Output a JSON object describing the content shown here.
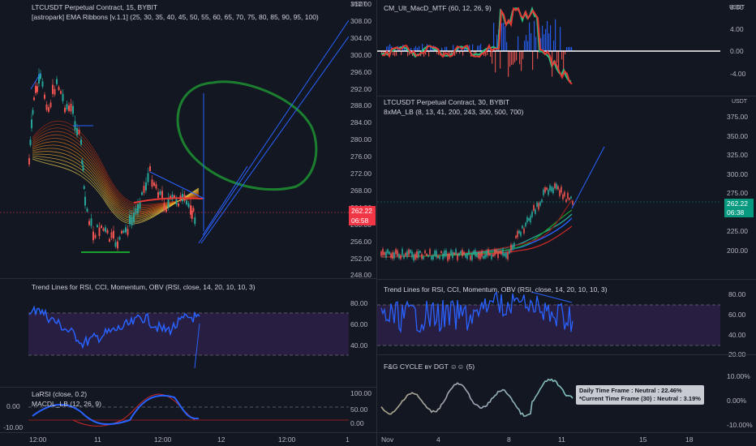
{
  "left": {
    "main": {
      "symbol": "LTCUSDT Perpetual Contract, 15, BYBIT",
      "indicator": "[astropark] EMA Ribbons [v.1.1] (25, 30, 35, 40, 45, 50, 55, 60, 65, 70, 75, 80, 85, 90, 95, 100)",
      "currency": "USDT",
      "price_axis": [
        "312.00",
        "308.00",
        "304.00",
        "300.00",
        "296.00",
        "292.00",
        "288.00",
        "284.00",
        "280.00",
        "276.00",
        "272.00",
        "268.00",
        "264.00",
        "260.00",
        "256.00",
        "252.00",
        "248.00"
      ],
      "price_tag": "262.22",
      "time_tag": "06:58"
    },
    "rsi_pane": {
      "title": "Trend Lines for RSI, CCI, Momentum, OBV (RSI, close, 14, 20, 10, 10, 3)",
      "axis": [
        "80.00",
        "60.00",
        "40.00"
      ]
    },
    "bottom_pane": {
      "title1": "LaRSI (close, 0.2)",
      "title2": "MACDL_LB (12, 26, 9)",
      "axis": [
        "100.00",
        "50.00",
        "0.00"
      ],
      "left_axis": [
        "0.00",
        "-10.00"
      ]
    },
    "time_axis": [
      "12:00",
      "11",
      "12:00",
      "12",
      "12:00",
      "1"
    ]
  },
  "right": {
    "macd": {
      "title": "CM_Ult_MacD_MTF (60, 12, 26, 9)",
      "currency": "USDT",
      "axis": [
        "8.00",
        "4.00",
        "0.00",
        "-4.00"
      ]
    },
    "main": {
      "symbol": "LTCUSDT Perpetual Contract, 30, BYBIT",
      "indicator": "8xMA_LB (8, 13, 41, 200, 243, 300, 500, 700)",
      "currency": "USDT",
      "price_axis": [
        "375.00",
        "350.00",
        "325.00",
        "300.00",
        "275.00",
        "250.00",
        "225.00",
        "200.00"
      ],
      "price_tag": "262.22",
      "time_tag": "06:38"
    },
    "rsi_pane": {
      "title": "Trend Lines for RSI, CCI, Momentum, OBV (RSI, close, 14, 20, 10, 10, 3)",
      "axis": [
        "80.00",
        "60.00",
        "40.00",
        "20.00"
      ]
    },
    "fg_pane": {
      "title": "F&G CYCLE ʙʏ DGT ☺☺ (5)",
      "axis": [
        "10.00%",
        "0.00%",
        "-10.00%"
      ],
      "tooltip_line1": "Daily Time Frame : Neutral : 22.46%",
      "tooltip_line2": "*Current Time Frame (30) : Neutral : 3.19%"
    },
    "time_axis": [
      "Nov",
      "4",
      "8",
      "11",
      "15",
      "18"
    ]
  },
  "colors": {
    "bg": "#131722",
    "up": "#26a69a",
    "down": "#ef5350",
    "rsi": "#2962ff",
    "price_tag_left": "#f23645",
    "price_tag_right": "#089981"
  }
}
